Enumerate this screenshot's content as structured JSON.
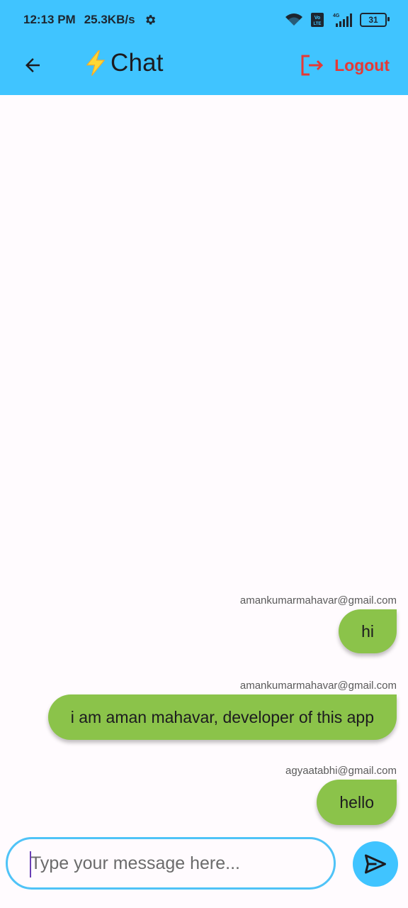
{
  "status_bar": {
    "time": "12:13 PM",
    "speed": "25.3KB/s",
    "battery": "31",
    "icons": [
      "settings-gear-icon",
      "wifi-icon",
      "volte-icon",
      "signal-4g-icon",
      "battery-icon"
    ]
  },
  "app_bar": {
    "title": "Chat",
    "title_icon": "lightning-bolt-icon",
    "logout_label": "Logout",
    "colors": {
      "bar": "#40c4ff",
      "logout": "#e53935"
    }
  },
  "messages": [
    {
      "sender": "amankumarmahavar@gmail.com",
      "text": "hi"
    },
    {
      "sender": "amankumarmahavar@gmail.com",
      "text": "i am aman mahavar, developer of this app"
    },
    {
      "sender": "agyaatabhi@gmail.com",
      "text": "hello"
    }
  ],
  "composer": {
    "placeholder": "Type your message here...",
    "value": ""
  },
  "colors": {
    "bubble": "#8bc34a",
    "accent": "#4fc3f7"
  }
}
